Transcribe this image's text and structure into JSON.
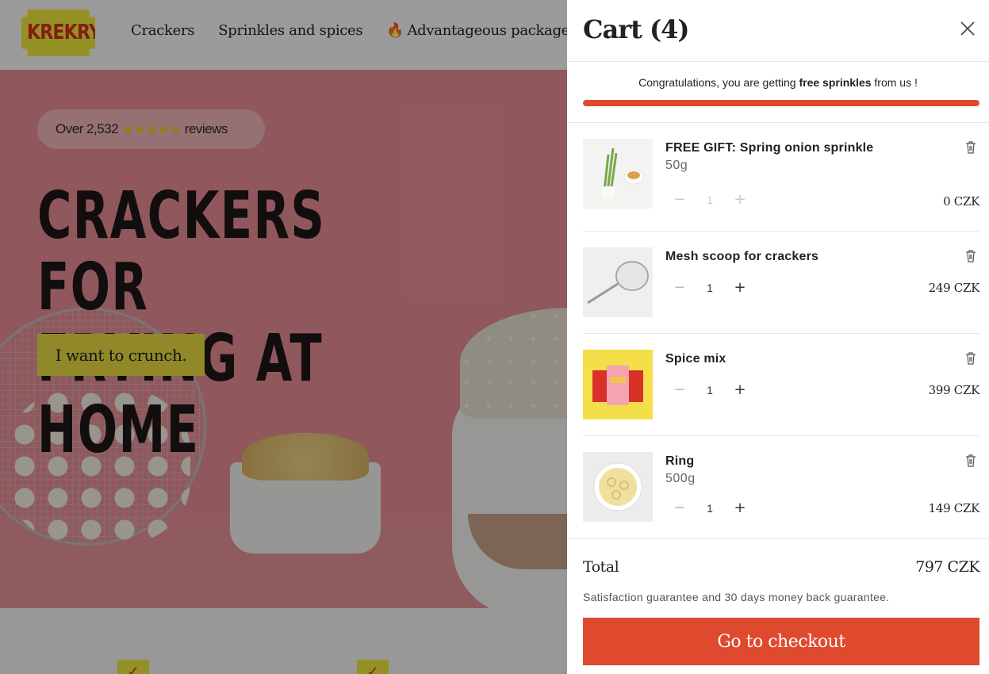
{
  "site": {
    "logo_text": "KREKRY",
    "nav": [
      {
        "label": "Crackers"
      },
      {
        "label": "Sprinkles and spices"
      },
      {
        "label": "Advantageous packages",
        "icon": "fire-icon"
      }
    ],
    "hero": {
      "rating_prefix": "Over 2,532",
      "rating_stars": "★★★★★",
      "rating_suffix": "reviews",
      "title_line1": "CRACKERS FOR",
      "title_line2": "FRYING AT HOME",
      "cta": "I want to crunch."
    }
  },
  "cart": {
    "title": "Cart (4)",
    "promo_before": "Congratulations, you are getting ",
    "promo_bold": "free sprinkles",
    "promo_after": " from us !",
    "progress": 1.0,
    "items": [
      {
        "name": "FREE GIFT: Spring onion sprinkle",
        "variant": "50g",
        "quantity": "1",
        "price": "0 CZK",
        "qty_disabled": true
      },
      {
        "name": "Mesh scoop for crackers",
        "variant": "",
        "quantity": "1",
        "price": "249 CZK",
        "qty_disabled": false
      },
      {
        "name": "Spice mix",
        "variant": "",
        "quantity": "1",
        "price": "399 CZK",
        "qty_disabled": false
      },
      {
        "name": "Ring",
        "variant": "500g",
        "quantity": "1",
        "price": "149 CZK",
        "qty_disabled": false
      }
    ],
    "total_label": "Total",
    "total_value": "797 CZK",
    "guarantee": "Satisfaction guarantee and 30 days money back guarantee.",
    "checkout_label": "Go to checkout"
  },
  "colors": {
    "accent": "#df4a2e",
    "brand_yellow": "#f1e839",
    "hero_pink": "#e88f96"
  }
}
